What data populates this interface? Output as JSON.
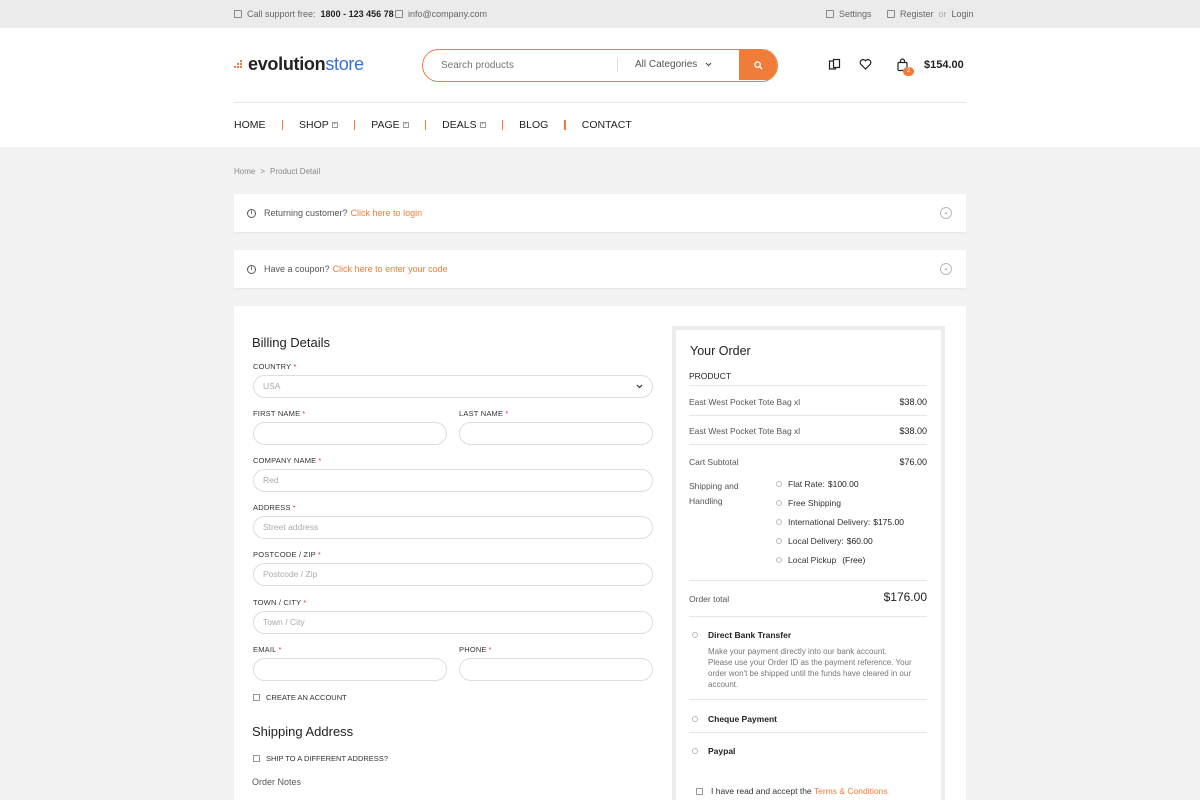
{
  "topbar": {
    "support_label": "Call support free:",
    "support_phone": "1800 - 123 456 78",
    "email": "info@company.com",
    "settings": "Settings",
    "register": "Register",
    "or": "or",
    "login": "Login"
  },
  "header": {
    "logo_evo": "evolution",
    "logo_store": "store",
    "search_placeholder": "Search products",
    "category": "All Categories",
    "cart_count": "2",
    "cart_total": "$154.00",
    "accent_color": "#f07c3a",
    "logo_store_color": "#3a6fd8"
  },
  "nav": {
    "items": [
      {
        "label": "HOME"
      },
      {
        "label": "SHOP"
      },
      {
        "label": "PAGE"
      },
      {
        "label": "DEALS"
      },
      {
        "label": "BLOG"
      },
      {
        "label": "CONTACT"
      }
    ]
  },
  "breadcrumb": {
    "home": "Home",
    "sep": ">",
    "current": "Product Detail"
  },
  "notices": {
    "returning_text": "Returning customer?",
    "returning_link": "Click here to login",
    "coupon_text": "Have a coupon?",
    "coupon_link": "Click here to enter your code"
  },
  "billing": {
    "title": "Billing Details",
    "country_label": "COUNTRY",
    "country_value": "USA",
    "first_name_label": "FIRST NAME",
    "last_name_label": "LAST NAME",
    "company_label": "COMPANY NAME",
    "company_value": "Red",
    "address_label": "ADDRESS",
    "address_placeholder": "Street address",
    "postcode_label": "POSTCODE / ZIP",
    "postcode_placeholder": "Postcode / Zip",
    "town_label": "TOWN / CITY",
    "town_placeholder": "Town / City",
    "email_label": "EMAIL",
    "phone_label": "PHONE",
    "create_account": "CREATE AN ACCOUNT",
    "required": "*"
  },
  "shipping": {
    "title": "Shipping Address",
    "ship_different": "SHIP TO A DIFFERENT ADDRESS?",
    "order_notes": "Order Notes"
  },
  "order": {
    "title": "Your Order",
    "product_header": "PRODUCT",
    "items": [
      {
        "name": "East West Pocket Tote Bag xl",
        "price": "$38.00"
      },
      {
        "name": "East West Pocket Tote Bag xl",
        "price": "$38.00"
      }
    ],
    "subtotal_label": "Cart Subtotal",
    "subtotal_value": "$76.00",
    "shipping_label": "Shipping and Handling",
    "shipping_options": [
      {
        "label": "Flat Rate:",
        "price": "$100.00"
      },
      {
        "label": "Free Shipping",
        "price": ""
      },
      {
        "label": "International Delivery:",
        "price": "$175.00"
      },
      {
        "label": "Local Delivery:",
        "price": "$60.00"
      },
      {
        "label": "Local Pickup",
        "price": "(Free)"
      }
    ],
    "total_label": "Order total",
    "total_value": "$176.00",
    "payments": {
      "bank": "Direct Bank Transfer",
      "bank_desc": "Make your payment directly into our bank account. Please use your Order ID as the payment reference. Your order won't be shipped until the funds have cleared in our account.",
      "cheque": "Cheque Payment",
      "paypal": "Paypal"
    },
    "terms_text": "I have read and accept the",
    "terms_link": "Terms & Conditions"
  }
}
